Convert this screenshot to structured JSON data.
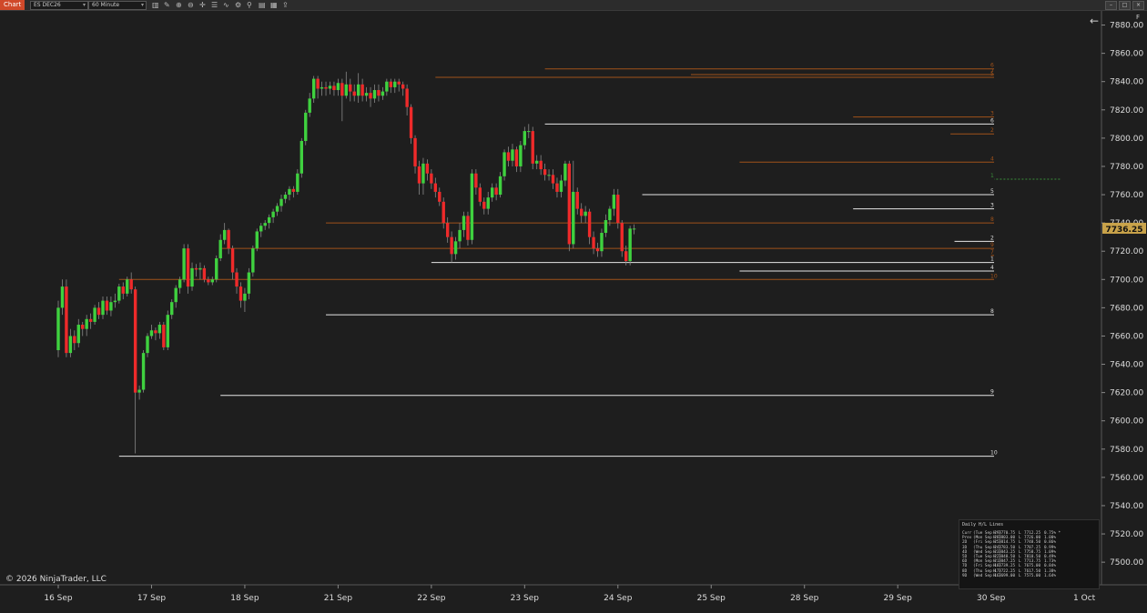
{
  "toolbar": {
    "tab_label": "Chart",
    "instrument": "ES DEC26",
    "interval": "60 Minute",
    "accent_color": "#d0492a"
  },
  "icons": [
    "bar-style-icon",
    "draw-tools-icon",
    "zoom-in-icon",
    "zoom-out-icon",
    "crosshair-icon",
    "properties-icon",
    "indicators-icon",
    "strategy-icon",
    "attach-icon",
    "template-icon",
    "data-box-icon",
    "share-icon"
  ],
  "copyright": "© 2026 NinjaTrader, LLC",
  "panel_flag": "F",
  "chart_data": {
    "type": "candlestick",
    "colors": {
      "up": "#3fd13f",
      "down": "#ee2a2a",
      "background": "#1e1e1e",
      "white_line": "#e6e6e6",
      "orange_line": "#a0521a",
      "green_line": "#3a8f3a",
      "price_badge": "#c9a34a"
    },
    "ylim": [
      7484,
      7890
    ],
    "y_ticks": [
      7500,
      7520,
      7540,
      7560,
      7580,
      7600,
      7620,
      7640,
      7660,
      7680,
      7700,
      7720,
      7740,
      7760,
      7780,
      7800,
      7820,
      7840,
      7860,
      7880
    ],
    "x_ticks": [
      {
        "label": "16 Sep",
        "x": 0
      },
      {
        "label": "17 Sep",
        "x": 23
      },
      {
        "label": "18 Sep",
        "x": 46
      },
      {
        "label": "21 Sep",
        "x": 69
      },
      {
        "label": "22 Sep",
        "x": 92
      },
      {
        "label": "23 Sep",
        "x": 115
      },
      {
        "label": "24 Sep",
        "x": 138
      },
      {
        "label": "25 Sep",
        "x": 161
      },
      {
        "label": "28 Sep",
        "x": 184
      },
      {
        "label": "29 Sep",
        "x": 207
      },
      {
        "label": "30 Sep",
        "x": 230
      },
      {
        "label": "1 Oct",
        "x": 253
      }
    ],
    "last_price": "7736.25",
    "candles": [
      [
        7650,
        7680,
        7645,
        7685
      ],
      [
        7680,
        7695,
        7675,
        7700
      ],
      [
        7695,
        7648,
        7645,
        7700
      ],
      [
        7648,
        7660,
        7645,
        7665
      ],
      [
        7660,
        7655,
        7650,
        7664
      ],
      [
        7655,
        7668,
        7652,
        7672
      ],
      [
        7668,
        7665,
        7660,
        7670
      ],
      [
        7665,
        7672,
        7660,
        7675
      ],
      [
        7672,
        7670,
        7665,
        7676
      ],
      [
        7670,
        7680,
        7668,
        7682
      ],
      [
        7680,
        7675,
        7672,
        7684
      ],
      [
        7675,
        7685,
        7672,
        7688
      ],
      [
        7685,
        7678,
        7675,
        7688
      ],
      [
        7678,
        7684,
        7674,
        7688
      ],
      [
        7684,
        7685,
        7680,
        7690
      ],
      [
        7685,
        7695,
        7683,
        7697
      ],
      [
        7695,
        7690,
        7686,
        7698
      ],
      [
        7690,
        7700,
        7688,
        7702
      ],
      [
        7700,
        7693,
        7690,
        7705
      ],
      [
        7693,
        7620,
        7577,
        7695
      ],
      [
        7620,
        7622,
        7615,
        7625
      ],
      [
        7622,
        7648,
        7620,
        7650
      ],
      [
        7648,
        7660,
        7645,
        7662
      ],
      [
        7660,
        7664,
        7658,
        7668
      ],
      [
        7664,
        7662,
        7657,
        7666
      ],
      [
        7662,
        7668,
        7658,
        7670
      ],
      [
        7668,
        7652,
        7650,
        7670
      ],
      [
        7652,
        7675,
        7650,
        7678
      ],
      [
        7675,
        7684,
        7672,
        7686
      ],
      [
        7684,
        7694,
        7680,
        7696
      ],
      [
        7694,
        7700,
        7690,
        7702
      ],
      [
        7700,
        7722,
        7698,
        7725
      ],
      [
        7722,
        7695,
        7690,
        7725
      ],
      [
        7695,
        7708,
        7692,
        7712
      ],
      [
        7708,
        7707,
        7702,
        7711
      ],
      [
        7707,
        7708,
        7700,
        7712
      ],
      [
        7708,
        7700,
        7698,
        7710
      ],
      [
        7700,
        7698,
        7696,
        7702
      ],
      [
        7698,
        7700,
        7696,
        7702
      ],
      [
        7700,
        7715,
        7698,
        7717
      ],
      [
        7715,
        7728,
        7713,
        7732
      ],
      [
        7728,
        7735,
        7725,
        7740
      ],
      [
        7735,
        7722,
        7718,
        7736
      ],
      [
        7722,
        7705,
        7700,
        7724
      ],
      [
        7705,
        7695,
        7690,
        7708
      ],
      [
        7695,
        7685,
        7680,
        7698
      ],
      [
        7685,
        7690,
        7677,
        7694
      ],
      [
        7690,
        7705,
        7686,
        7708
      ],
      [
        7705,
        7722,
        7702,
        7724
      ],
      [
        7722,
        7734,
        7720,
        7736
      ],
      [
        7734,
        7738,
        7730,
        7740
      ],
      [
        7738,
        7740,
        7735,
        7742
      ],
      [
        7740,
        7744,
        7736,
        7746
      ],
      [
        7744,
        7748,
        7740,
        7750
      ],
      [
        7748,
        7752,
        7745,
        7754
      ],
      [
        7752,
        7757,
        7748,
        7760
      ],
      [
        7757,
        7760,
        7754,
        7762
      ],
      [
        7760,
        7764,
        7756,
        7766
      ],
      [
        7764,
        7762,
        7758,
        7766
      ],
      [
        7762,
        7775,
        7760,
        7778
      ],
      [
        7775,
        7798,
        7772,
        7800
      ],
      [
        7798,
        7818,
        7795,
        7820
      ],
      [
        7818,
        7828,
        7815,
        7832
      ],
      [
        7828,
        7842,
        7825,
        7844
      ],
      [
        7842,
        7835,
        7828,
        7844
      ],
      [
        7835,
        7836,
        7830,
        7840
      ],
      [
        7836,
        7835,
        7830,
        7840
      ],
      [
        7835,
        7837,
        7831,
        7840
      ],
      [
        7837,
        7834,
        7830,
        7840
      ],
      [
        7834,
        7839,
        7830,
        7842
      ],
      [
        7839,
        7830,
        7812,
        7842
      ],
      [
        7830,
        7838,
        7828,
        7847
      ],
      [
        7838,
        7833,
        7826,
        7842
      ],
      [
        7833,
        7830,
        7826,
        7838
      ],
      [
        7830,
        7838,
        7825,
        7846
      ],
      [
        7838,
        7830,
        7826,
        7842
      ],
      [
        7830,
        7832,
        7826,
        7836
      ],
      [
        7832,
        7828,
        7822,
        7836
      ],
      [
        7828,
        7834,
        7825,
        7838
      ],
      [
        7834,
        7830,
        7826,
        7838
      ],
      [
        7830,
        7833,
        7827,
        7836
      ],
      [
        7833,
        7840,
        7830,
        7842
      ],
      [
        7840,
        7836,
        7832,
        7842
      ],
      [
        7836,
        7840,
        7832,
        7842
      ],
      [
        7840,
        7838,
        7833,
        7842
      ],
      [
        7838,
        7835,
        7830,
        7840
      ],
      [
        7835,
        7822,
        7816,
        7838
      ],
      [
        7822,
        7800,
        7796,
        7824
      ],
      [
        7800,
        7780,
        7775,
        7802
      ],
      [
        7780,
        7768,
        7760,
        7784
      ],
      [
        7768,
        7782,
        7760,
        7786
      ],
      [
        7782,
        7775,
        7770,
        7785
      ],
      [
        7775,
        7768,
        7764,
        7778
      ],
      [
        7768,
        7762,
        7758,
        7772
      ],
      [
        7762,
        7755,
        7752,
        7765
      ],
      [
        7755,
        7740,
        7736,
        7758
      ],
      [
        7740,
        7730,
        7726,
        7744
      ],
      [
        7730,
        7718,
        7712,
        7734
      ],
      [
        7718,
        7727,
        7714,
        7730
      ],
      [
        7727,
        7735,
        7722,
        7740
      ],
      [
        7735,
        7745,
        7730,
        7748
      ],
      [
        7745,
        7728,
        7724,
        7748
      ],
      [
        7728,
        7775,
        7725,
        7778
      ],
      [
        7775,
        7765,
        7760,
        7778
      ],
      [
        7765,
        7755,
        7752,
        7768
      ],
      [
        7755,
        7750,
        7746,
        7758
      ],
      [
        7750,
        7758,
        7746,
        7762
      ],
      [
        7758,
        7765,
        7755,
        7768
      ],
      [
        7765,
        7760,
        7756,
        7768
      ],
      [
        7760,
        7773,
        7758,
        7776
      ],
      [
        7773,
        7790,
        7770,
        7792
      ],
      [
        7790,
        7784,
        7780,
        7794
      ],
      [
        7784,
        7792,
        7780,
        7796
      ],
      [
        7792,
        7780,
        7776,
        7794
      ],
      [
        7780,
        7795,
        7776,
        7798
      ],
      [
        7795,
        7805,
        7792,
        7808
      ],
      [
        7805,
        7805,
        7800,
        7810
      ],
      [
        7805,
        7782,
        7778,
        7808
      ],
      [
        7782,
        7784,
        7778,
        7788
      ],
      [
        7784,
        7778,
        7774,
        7788
      ],
      [
        7778,
        7774,
        7770,
        7782
      ],
      [
        7774,
        7774,
        7770,
        7778
      ],
      [
        7774,
        7768,
        7764,
        7778
      ],
      [
        7768,
        7762,
        7758,
        7772
      ],
      [
        7762,
        7770,
        7758,
        7774
      ],
      [
        7770,
        7782,
        7766,
        7784
      ],
      [
        7782,
        7725,
        7720,
        7784
      ],
      [
        7725,
        7762,
        7722,
        7784
      ],
      [
        7762,
        7750,
        7746,
        7765
      ],
      [
        7750,
        7745,
        7740,
        7754
      ],
      [
        7745,
        7748,
        7740,
        7752
      ],
      [
        7748,
        7730,
        7725,
        7750
      ],
      [
        7730,
        7722,
        7718,
        7734
      ],
      [
        7722,
        7720,
        7716,
        7726
      ],
      [
        7720,
        7733,
        7716,
        7736
      ],
      [
        7733,
        7742,
        7730,
        7746
      ],
      [
        7742,
        7750,
        7738,
        7752
      ],
      [
        7750,
        7760,
        7745,
        7764
      ],
      [
        7760,
        7740,
        7736,
        7764
      ],
      [
        7740,
        7720,
        7716,
        7742
      ],
      [
        7720,
        7713,
        7710,
        7724
      ],
      [
        7713,
        7736,
        7710,
        7738
      ],
      [
        7736,
        7736,
        7732,
        7739
      ]
    ],
    "levels": [
      {
        "price": 7849,
        "from": 120,
        "color": "orange",
        "label": "6"
      },
      {
        "price": 7845,
        "from": 156,
        "color": "orange",
        "label": "7"
      },
      {
        "price": 7843,
        "from": 93,
        "color": "orange",
        "label": "5"
      },
      {
        "price": 7815,
        "from": 196,
        "color": "orange",
        "label": "3"
      },
      {
        "price": 7810,
        "from": 120,
        "color": "white",
        "label": "6"
      },
      {
        "price": 7803,
        "from": 220,
        "color": "orange",
        "label": "2"
      },
      {
        "price": 7783,
        "from": 168,
        "color": "orange",
        "label": "4"
      },
      {
        "price": 7771,
        "from": 247,
        "color": "green",
        "label": "1"
      },
      {
        "price": 7760,
        "from": 144,
        "color": "white",
        "label": "5"
      },
      {
        "price": 7750,
        "from": 196,
        "color": "white",
        "label": "3"
      },
      {
        "price": 7740,
        "from": 66,
        "color": "orange",
        "label": "8"
      },
      {
        "price": 7727,
        "from": 221,
        "color": "white",
        "label": "2"
      },
      {
        "price": 7722,
        "from": 40,
        "color": "orange",
        "label": "9"
      },
      {
        "price": 7717,
        "from": 230,
        "color": "orange",
        "label": "7"
      },
      {
        "price": 7712,
        "from": 92,
        "color": "white",
        "label": "1"
      },
      {
        "price": 7706,
        "from": 168,
        "color": "white",
        "label": "4"
      },
      {
        "price": 7700,
        "from": 15,
        "color": "orange",
        "label": "10"
      },
      {
        "price": 7675,
        "from": 66,
        "color": "white",
        "label": "8"
      },
      {
        "price": 7618,
        "from": 40,
        "color": "white",
        "label": "9"
      },
      {
        "price": 7575,
        "from": 15,
        "color": "white",
        "label": "10"
      }
    ]
  },
  "hl_table": {
    "title": "Daily H/L Lines",
    "rows": [
      [
        "Curr",
        "(Tue Sep 29)",
        "H",
        "7770.75",
        "L",
        "7712.25",
        "0.75% *"
      ],
      [
        "Prev",
        "(Mon Sep 28)",
        "H",
        "7803.00",
        "L",
        "7726.00",
        "1.00%"
      ],
      [
        "2D",
        "(Fri Sep 25)",
        "H",
        "7814.75",
        "L",
        "7748.50",
        "0.86%"
      ],
      [
        "3D",
        "(Thu Sep 24)",
        "H",
        "7783.50",
        "L",
        "7707.25",
        "0.99%"
      ],
      [
        "4D",
        "(Wed Sep 23)",
        "H",
        "7843.25",
        "L",
        "7758.75",
        "1.09%"
      ],
      [
        "5D",
        "(Tue Sep 22)",
        "H",
        "7848.50",
        "L",
        "7810.50",
        "0.49%"
      ],
      [
        "6D",
        "(Mon Sep 21)",
        "H",
        "7847.25",
        "L",
        "7713.75",
        "1.73%"
      ],
      [
        "7D",
        "(Fri Sep 18)",
        "H",
        "7739.25",
        "L",
        "7675.00",
        "0.84%"
      ],
      [
        "8D",
        "(Thu Sep 17)",
        "H",
        "7722.25",
        "L",
        "7617.50",
        "1.38%"
      ],
      [
        "9D",
        "(Wed Sep 16)",
        "H",
        "7699.00",
        "L",
        "7575.00",
        "1.64%"
      ]
    ]
  }
}
